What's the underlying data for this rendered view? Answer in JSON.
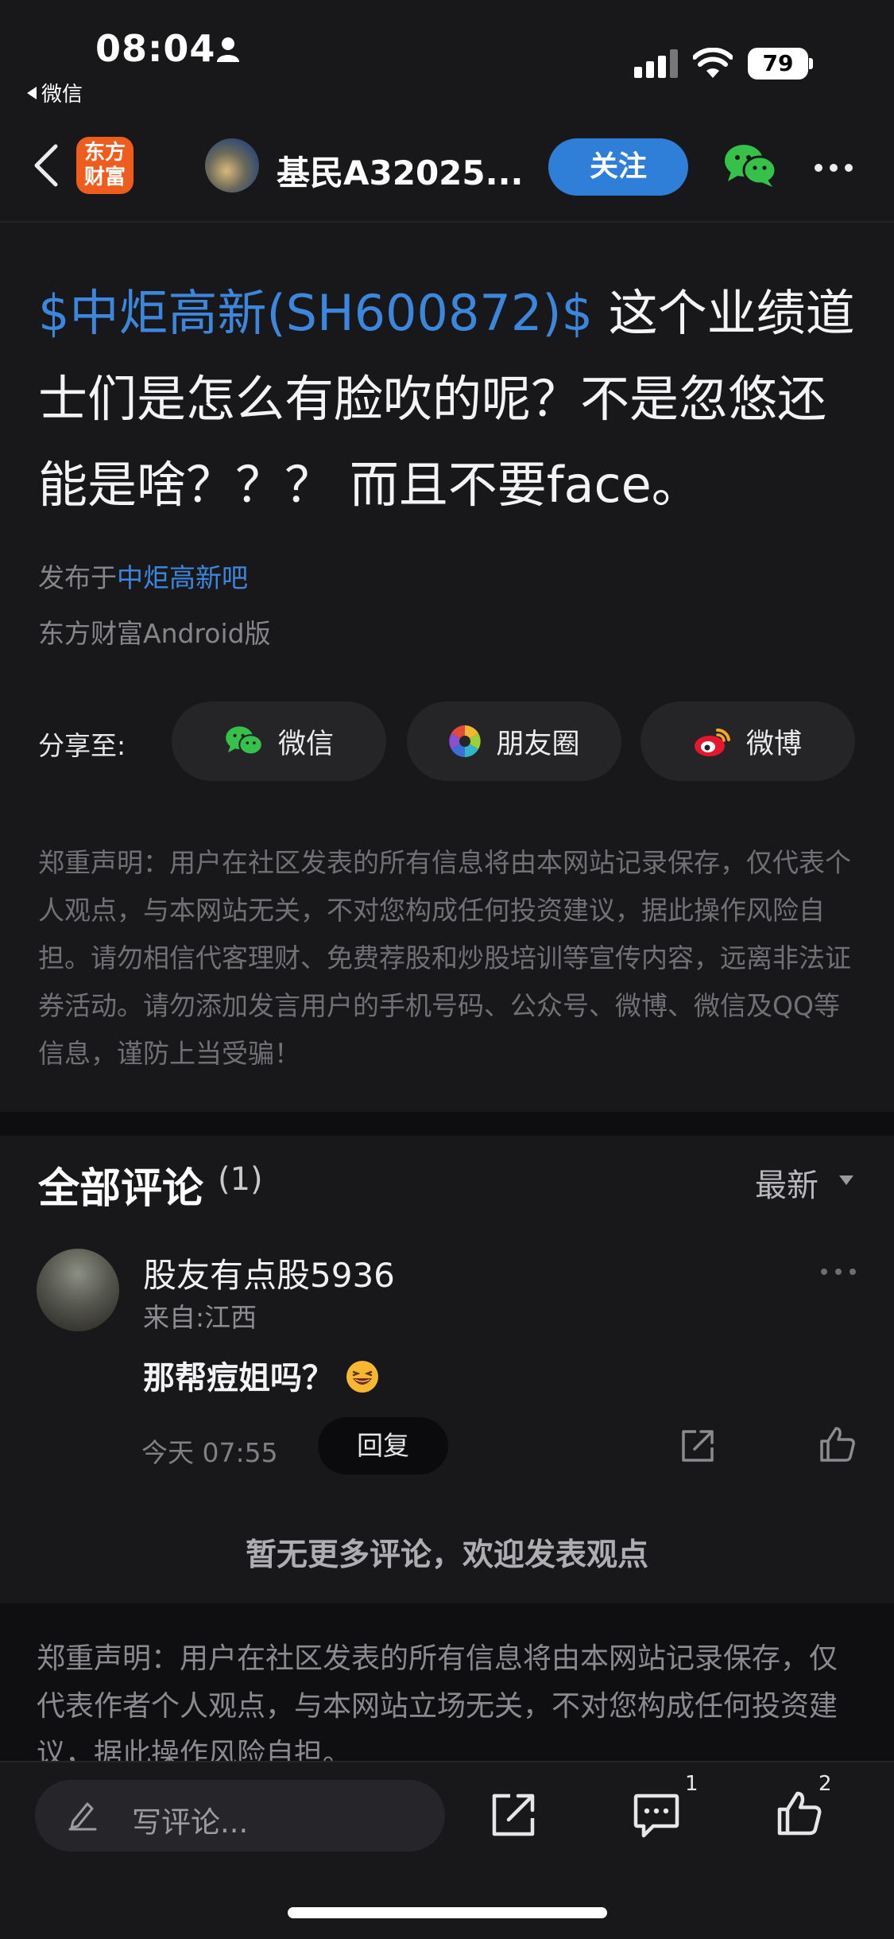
{
  "status_bar": {
    "time": "08:04",
    "back_app": "微信",
    "battery": "79"
  },
  "nav": {
    "logo_text": "东方财富",
    "user_name": "基民A32025...",
    "follow_label": "关注"
  },
  "post": {
    "stock_tag": "$中炬高新(SH600872)$",
    "body": "  这个业绩道士们是怎么有脸吹的呢？不是忽悠还能是啥？？？ 而且不要face。",
    "published_prefix": "发布于",
    "forum": "中炬高新吧",
    "platform": "东方财富Android版"
  },
  "share": {
    "label": "分享至:",
    "wechat": "微信",
    "moments": "朋友圈",
    "weibo": "微博"
  },
  "disclaimer_top": "郑重声明：用户在社区发表的所有信息将由本网站记录保存，仅代表个人观点，与本网站无关，不对您构成任何投资建议，据此操作风险自担。请勿相信代客理财、免费荐股和炒股培训等宣传内容，远离非法证券活动。请勿添加发言用户的手机号码、公众号、微博、微信及QQ等信息，谨防上当受骗！",
  "comments": {
    "title": "全部评论",
    "count": "(1)",
    "sort": "最新",
    "items": [
      {
        "user": "股友有点股5936",
        "location": "来自:江西",
        "text": "那帮痘姐吗？",
        "time": "今天 07:55",
        "reply_label": "回复"
      }
    ],
    "no_more": "暂无更多评论，欢迎发表观点"
  },
  "disclaimer_bottom": "郑重声明：用户在社区发表的所有信息将由本网站记录保存，仅代表作者个人观点，与本网站立场无关，不对您构成任何投资建议，据此操作风险自担。",
  "bottom_bar": {
    "placeholder": "写评论...",
    "comment_count": "1",
    "like_count": "2"
  }
}
